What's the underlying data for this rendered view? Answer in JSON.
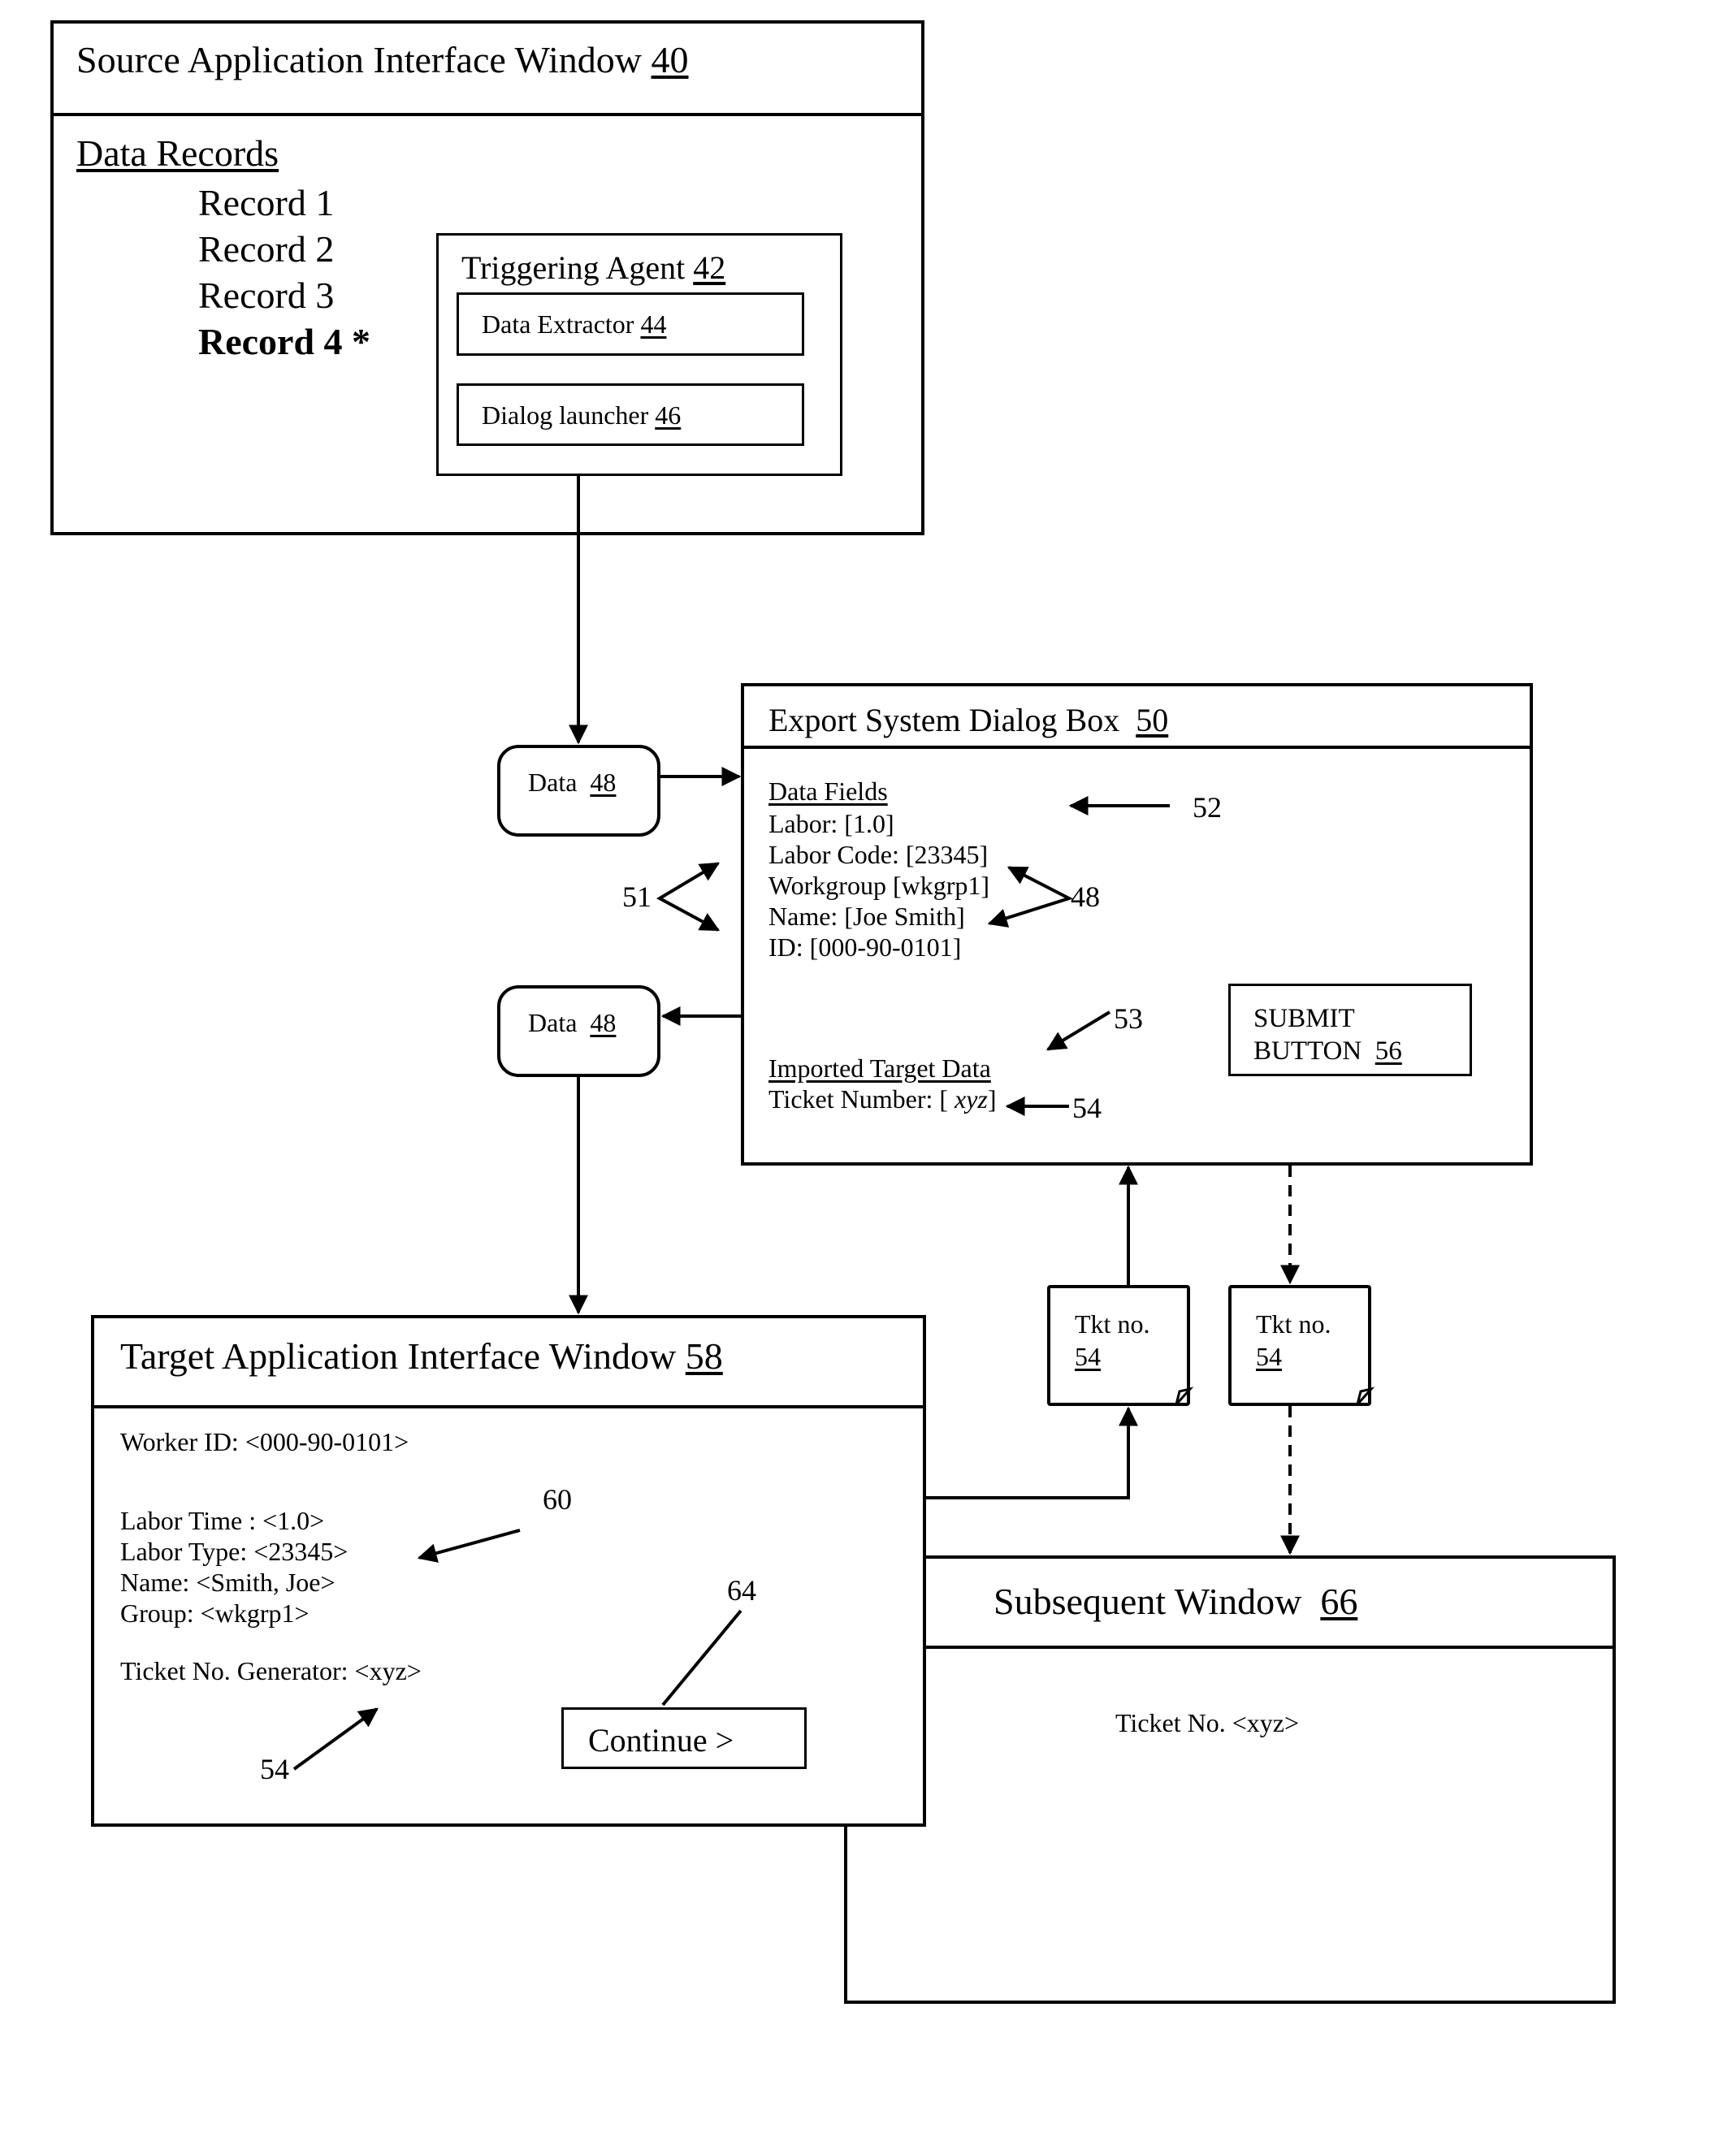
{
  "source_window": {
    "title": "Source Application Interface Window",
    "ref": "40",
    "section_label": "Data Records",
    "records": [
      "Record 1",
      "Record 2",
      "Record 3",
      "Record 4 *"
    ],
    "selected_record_index": 3,
    "triggering_agent": {
      "title": "Triggering Agent",
      "ref": "42",
      "data_extractor": {
        "label": "Data Extractor",
        "ref": "44"
      },
      "dialog_launcher": {
        "label": "Dialog launcher",
        "ref": "46"
      }
    }
  },
  "data_tokens": [
    {
      "label": "Data",
      "ref": "48"
    },
    {
      "label": "Data",
      "ref": "48"
    }
  ],
  "export_dialog": {
    "title": "Export System Dialog Box",
    "ref": "50",
    "data_fields_label": "Data Fields",
    "fields": [
      "Labor: [1.0]",
      "Labor Code: [23345]",
      "Workgroup [wkgrp1]",
      "Name: [Joe Smith]",
      "ID: [000-90-0101]"
    ],
    "imported_label": "Imported Target Data",
    "ticket_prefix": "Ticket Number: [ ",
    "ticket_value": "xyz",
    "ticket_suffix": "]",
    "submit_button": {
      "line1": "SUBMIT",
      "line2": "BUTTON",
      "ref": "56"
    }
  },
  "callouts": {
    "c51": "51",
    "c52": "52",
    "c48": "48",
    "c53": "53",
    "c54_dialog": "54",
    "c60": "60",
    "c64": "64",
    "c54_target": "54"
  },
  "ticket_notes": [
    {
      "label": "Tkt no.",
      "ref": "54"
    },
    {
      "label": "Tkt no.",
      "ref": "54"
    }
  ],
  "target_window": {
    "title": "Target Application Interface Window",
    "ref": "58",
    "worker_id": "Worker ID:  <000-90-0101>",
    "fields": [
      "Labor Time :  <1.0>",
      "Labor Type:  <23345>",
      "Name: <Smith, Joe>",
      "Group: <wkgrp1>"
    ],
    "ticket_generator": "Ticket No. Generator: <xyz>",
    "continue_button": "Continue  >"
  },
  "subsequent_window": {
    "title": "Subsequent Window",
    "ref": "66",
    "ticket": "Ticket No. <xyz>"
  }
}
